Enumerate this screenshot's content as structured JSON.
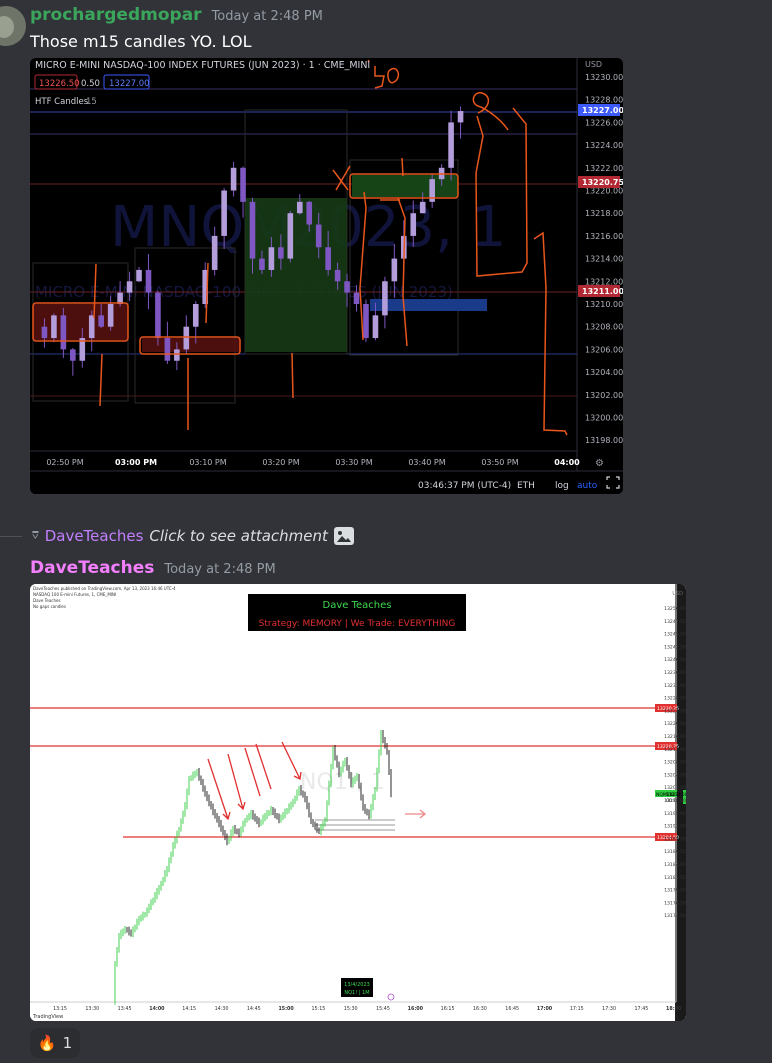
{
  "messages": [
    {
      "username": "prochargedmopar",
      "username_color": "#3ba55c",
      "timestamp": "Today at 2:48 PM",
      "text": "Those m15 candles YO.   LOL",
      "chart": {
        "title": "MICRO E-MINI NASDAQ-100 INDEX FUTURES (JUN 2023) · 1 · CME_MINI",
        "currency": "USD",
        "bid": "13226.50",
        "spread": "0.50",
        "ask": "13227.00",
        "indicator_name": "HTF Candles",
        "indicator_value": "15",
        "watermark_symbol": "MNQM2023, 1",
        "watermark_desc": "MICRO E-MINI NASDAQ-100 INDEX FUTURES (JUN 2023)",
        "price_labels": [
          "13230.00",
          "13228.00",
          "13226.00",
          "13224.00",
          "13222.00",
          "13220.00",
          "13218.00",
          "13216.00",
          "13214.00",
          "13212.00",
          "13210.00",
          "13208.00",
          "13206.00",
          "13204.00",
          "13202.00",
          "13200.00",
          "13198.00"
        ],
        "badges": [
          {
            "value": "13227.00",
            "color": "#3d5afe"
          },
          {
            "value": "13220.75",
            "color": "#b22833"
          },
          {
            "value": "13211.00",
            "color": "#b22833"
          }
        ],
        "time_labels": [
          "02:50 PM",
          "03:00 PM",
          "03:10 PM",
          "03:20 PM",
          "03:30 PM",
          "03:40 PM",
          "03:50 PM",
          "04:00"
        ],
        "status_time": "03:46:37 PM (UTC-4)",
        "status_session": "ETH",
        "status_log": "log",
        "status_auto": "auto",
        "annotations": [
          "50",
          "X"
        ]
      }
    },
    {
      "reply_username": "DaveTeaches",
      "reply_text": "Click to see attachment",
      "username": "DaveTeaches",
      "username_color": "#f47fff",
      "timestamp": "Today at 2:48 PM",
      "chart": {
        "header_line1": "DaveTeaches published on TradingView.com, Apr 13, 2023 16:46 UTC-4",
        "header_line2": "NASDAQ 100 E-mini Futures, 1, CME_MINI",
        "header_line3": "Dave Teaches",
        "header_line4": "No gaps candles",
        "banner_title": "Dave Teaches",
        "banner_sub": "Strategy: MEMORY  | We Trade: EVERYTHING",
        "currency": "USD",
        "price_labels": [
          "13250.00",
          "13247.50",
          "13245.00",
          "13242.50",
          "13240.00",
          "13236.00",
          "13232.00",
          "13228.00",
          "13224.00",
          "13220.00",
          "13216.00",
          "13212.00",
          "13208.00",
          "13204.00",
          "13201.00",
          "13198.00",
          "13195.00",
          "13192.00",
          "13189.00",
          "13186.50",
          "13184.00",
          "13181.50",
          "13179.00",
          "13176.50",
          "13174.00"
        ],
        "badges": [
          {
            "value": "13230.25",
            "color": "#e03030"
          },
          {
            "value": "13220.75",
            "color": "#e03030"
          },
          {
            "value": "13204.50",
            "color": "#e03030"
          }
        ],
        "live_symbol": "NQM2023",
        "live_price": "13213.00",
        "live_sub": "00:14",
        "time_labels": [
          "13:15",
          "13:30",
          "13:45",
          "14:00",
          "14:15",
          "14:30",
          "14:45",
          "15:00",
          "15:15",
          "15:30",
          "15:45",
          "16:00",
          "16:15",
          "16:30",
          "16:45",
          "17:00",
          "17:15",
          "17:30",
          "17:45",
          "18:00",
          "18:15",
          "18:30",
          "18:45",
          "19:00"
        ],
        "date_box_line1": "13/4/2023",
        "date_box_line2": "NQ1! | 1M",
        "footer": "TradingView"
      }
    }
  ],
  "reaction": {
    "emoji": "🔥",
    "count": "1"
  }
}
